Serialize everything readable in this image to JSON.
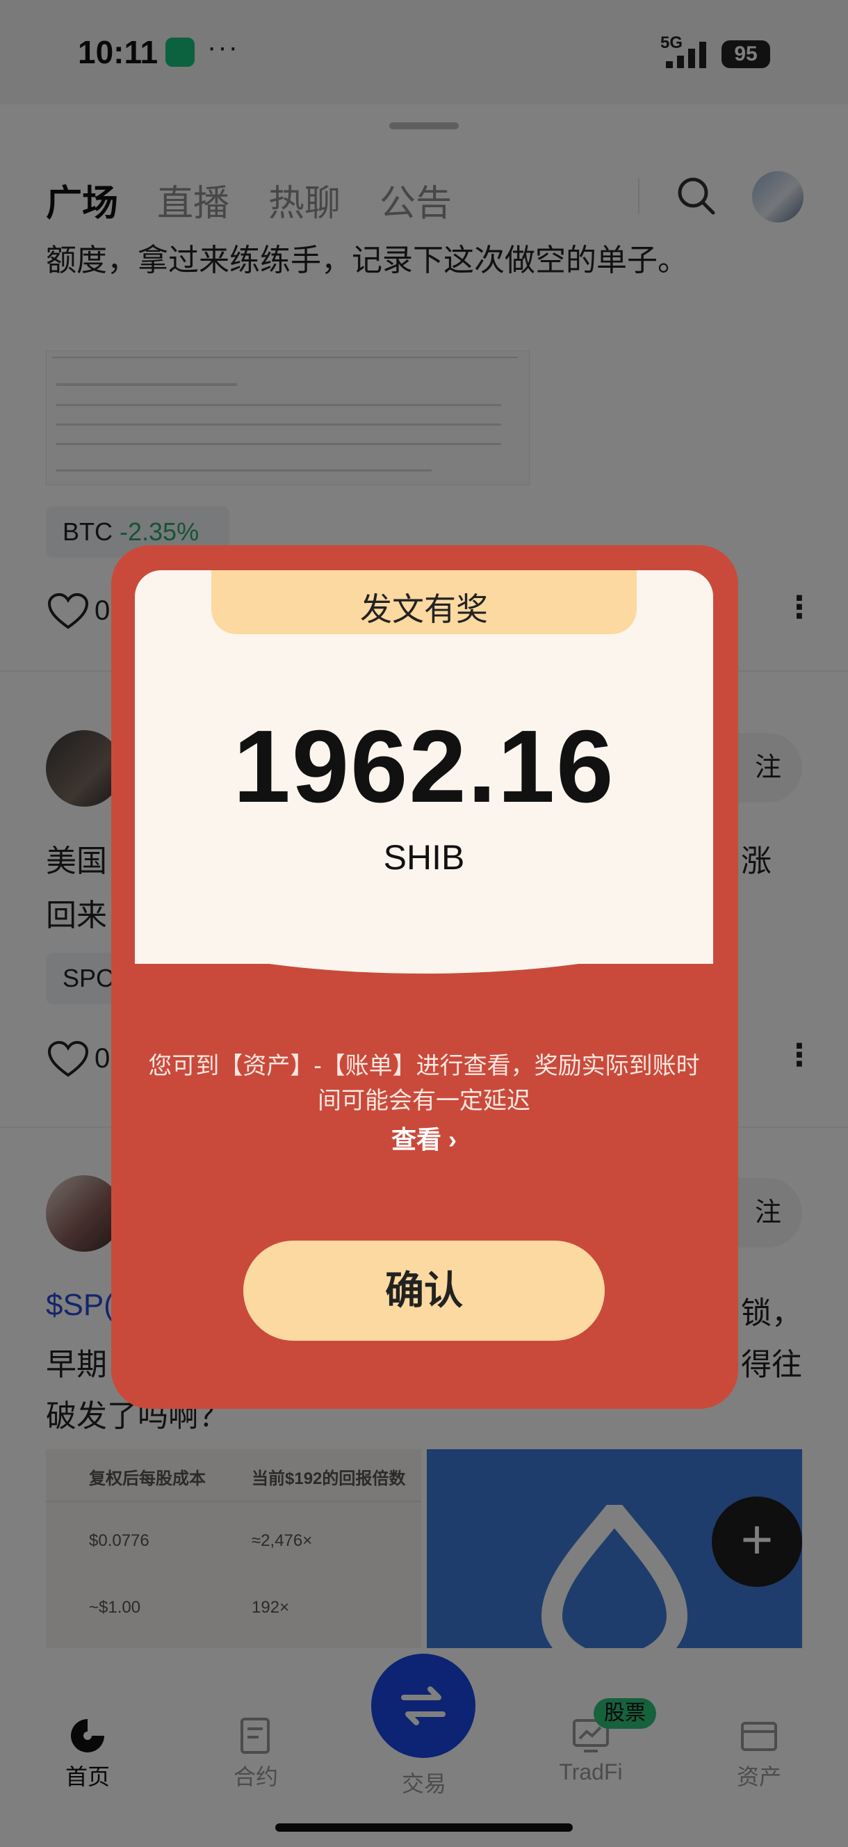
{
  "status_bar": {
    "time": "10:11",
    "dots": "···",
    "network": "5G",
    "battery": "95"
  },
  "tabs": [
    "广场",
    "直播",
    "热聊",
    "公告"
  ],
  "posts": {
    "p1": {
      "text": "额度，拿过来练练手，记录下这次做空的单子。",
      "tag_symbol": "BTC",
      "tag_change": "-2.35%",
      "likes": "0"
    },
    "p2": {
      "text_left_line1": "美国",
      "text_right_line1": "涨",
      "text_left_line2": "回来",
      "tag_symbol": "SPC",
      "likes": "0",
      "follow": "注"
    },
    "p3": {
      "text_link": "$SP(",
      "text_right_line1": "锁，",
      "text_left_line2": "早期",
      "text_right_line2": "得往",
      "text_line3": "破发了吗啊？",
      "follow": "注"
    }
  },
  "table_image": {
    "headers": [
      "复权后每股成本",
      "当前$192的回报倍数"
    ],
    "rows": [
      [
        "$0.0776",
        "≈2,476×"
      ],
      [
        "~$1.00",
        "192×"
      ]
    ]
  },
  "fab": "+",
  "bottom_nav": {
    "items": [
      {
        "label": "首页",
        "active": true
      },
      {
        "label": "合约"
      },
      {
        "label": "交易"
      },
      {
        "label": "TradFi"
      },
      {
        "label": "资产"
      }
    ],
    "badge": "股票"
  },
  "reward_modal": {
    "title": "发文有奖",
    "amount": "1962.16",
    "currency": "SHIB",
    "note": "您可到【资产】-【账单】进行查看，奖励实际到账时间可能会有一定延迟",
    "view_link": "查看",
    "confirm": "确认"
  },
  "colors": {
    "modal_red": "#c94a3b",
    "banner_gold": "#fcd9a0",
    "positive_green": "#27a86d",
    "trade_blue": "#1a47e6"
  }
}
